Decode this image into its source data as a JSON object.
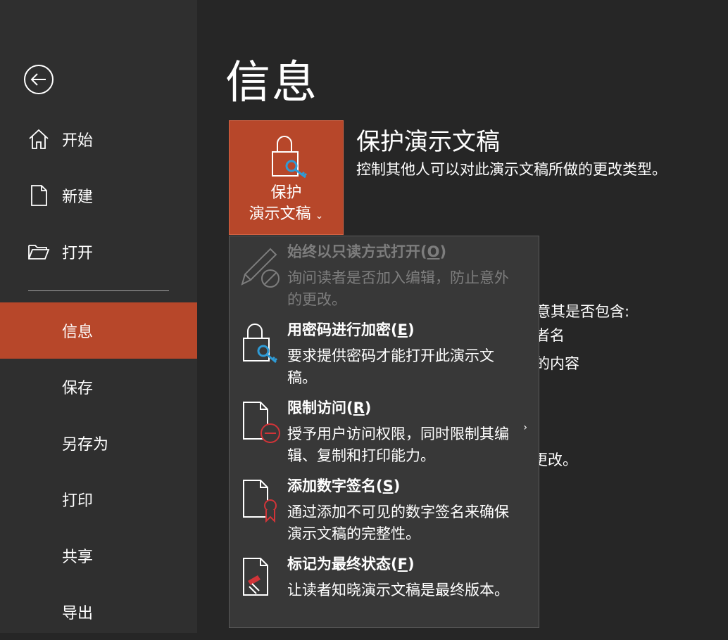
{
  "sidebar": {
    "items": [
      {
        "label": "开始"
      },
      {
        "label": "新建"
      },
      {
        "label": "打开"
      },
      {
        "label": "信息"
      },
      {
        "label": "保存"
      },
      {
        "label": "另存为"
      },
      {
        "label": "打印"
      },
      {
        "label": "共享"
      },
      {
        "label": "导出"
      }
    ]
  },
  "main": {
    "title": "信息",
    "protect": {
      "button_line1": "保护",
      "button_line2": "演示文稿",
      "chevron": "⌄",
      "heading": "保护演示文稿",
      "description": "控制其他人可以对此演示文稿所做的更改类型。"
    },
    "obscured": {
      "line1": "注意其是否包含:",
      "line2": "者名",
      "line3": "的内容",
      "line4": "更改。"
    }
  },
  "menu": {
    "items": [
      {
        "title": "始终以只读方式打开(",
        "key": "O",
        "close": ")",
        "desc": "询问读者是否加入编辑，防止意外的更改。",
        "disabled": true
      },
      {
        "title": "用密码进行加密(",
        "key": "E",
        "close": ")",
        "desc": "要求提供密码才能打开此演示文稿。",
        "disabled": false
      },
      {
        "title": "限制访问(",
        "key": "R",
        "close": ")",
        "desc": "授予用户访问权限，同时限制其编辑、复制和打印能力。",
        "disabled": false,
        "submenu": "›"
      },
      {
        "title": "添加数字签名(",
        "key": "S",
        "close": ")",
        "desc": "通过添加不可见的数字签名来确保演示文稿的完整性。",
        "disabled": false
      },
      {
        "title": "标记为最终状态(",
        "key": "F",
        "close": ")",
        "desc": "让读者知晓演示文稿是最终版本。",
        "disabled": false
      }
    ]
  },
  "colors": {
    "accent": "#b7472a",
    "sidebar": "#2f2f2f",
    "background": "#262626",
    "menu": "#383838",
    "key_icon": "#2e9bd6",
    "stop_icon": "#d13438"
  },
  "icons": [
    "back-arrow-icon",
    "home-icon",
    "new-document-icon",
    "open-folder-icon",
    "lock-key-icon",
    "pencil-disabled-icon",
    "document-restrict-icon",
    "document-ribbon-icon",
    "document-stamp-icon"
  ]
}
